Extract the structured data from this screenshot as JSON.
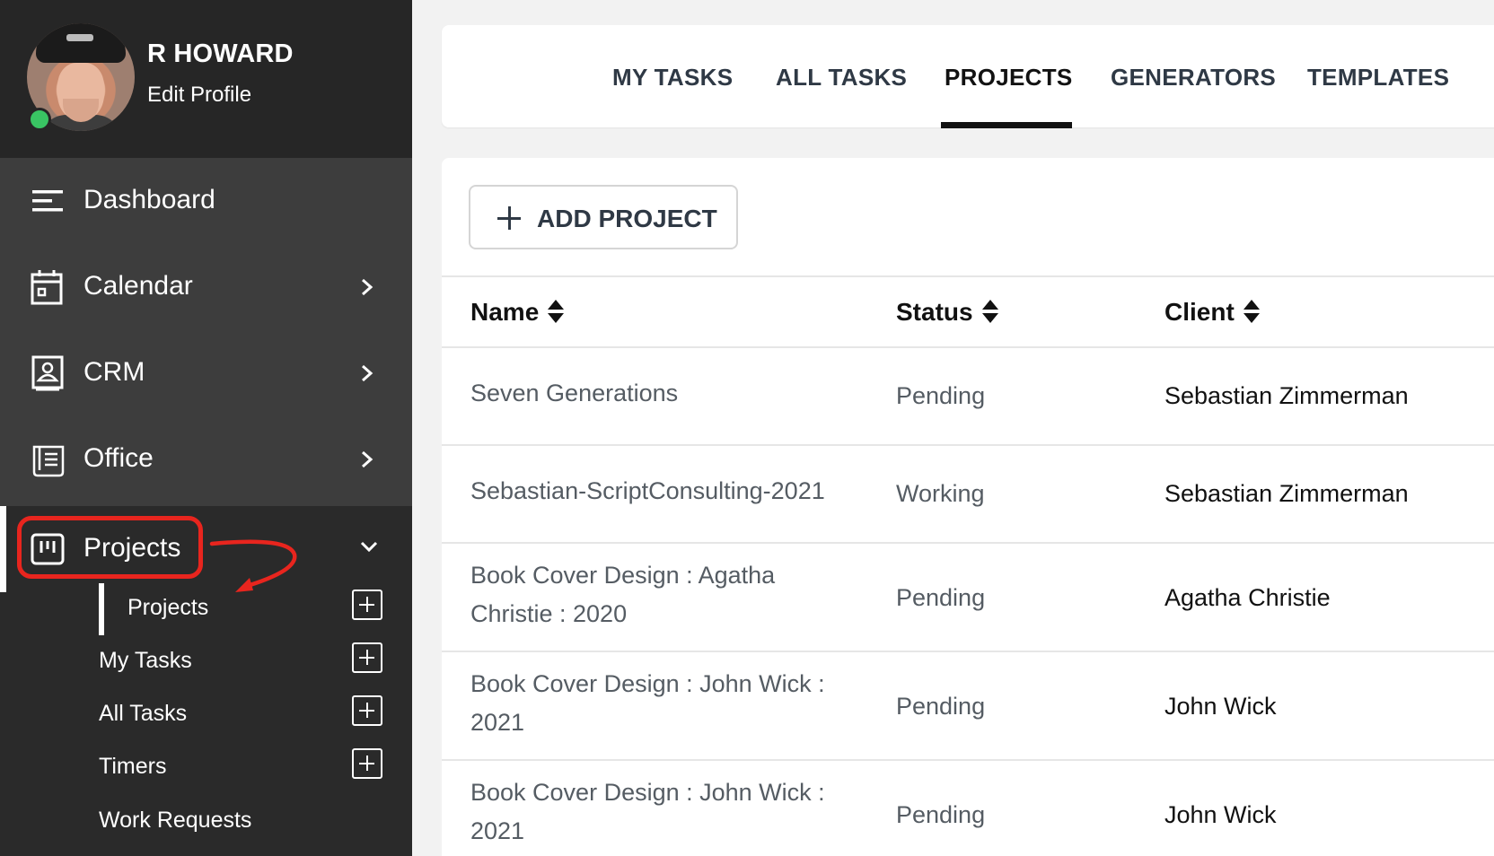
{
  "profile": {
    "name": "R HOWARD",
    "edit_label": "Edit Profile",
    "status_color": "#39c463"
  },
  "nav": {
    "items": [
      {
        "label": "Dashboard",
        "icon": "menu-icon"
      },
      {
        "label": "Calendar",
        "icon": "calendar-icon"
      },
      {
        "label": "CRM",
        "icon": "contact-card-icon"
      },
      {
        "label": "Office",
        "icon": "office-icon"
      }
    ],
    "active": {
      "label": "Projects",
      "icon": "kanban-board-icon"
    },
    "sub_items": [
      {
        "label": "Projects"
      },
      {
        "label": "My Tasks"
      },
      {
        "label": "All Tasks"
      },
      {
        "label": "Timers"
      },
      {
        "label": "Work Requests"
      }
    ]
  },
  "tabs": [
    {
      "label": "MY TASKS"
    },
    {
      "label": "ALL TASKS"
    },
    {
      "label": "PROJECTS"
    },
    {
      "label": "GENERATORS"
    },
    {
      "label": "TEMPLATES"
    }
  ],
  "toolbar": {
    "add_label": "ADD PROJECT"
  },
  "table": {
    "headers": {
      "name": "Name",
      "status": "Status",
      "client": "Client"
    },
    "rows": [
      {
        "name": "Seven Generations",
        "status": "Pending",
        "client": "Sebastian Zimmerman"
      },
      {
        "name": "Sebastian-ScriptConsulting-2021",
        "status": "Working",
        "client": "Sebastian Zimmerman"
      },
      {
        "name": "Book Cover Design : Agatha Christie : 2020",
        "status": "Pending",
        "client": "Agatha Christie"
      },
      {
        "name": "Book Cover Design : John Wick : 2021",
        "status": "Pending",
        "client": "John Wick"
      },
      {
        "name": "Book Cover Design : John Wick : 2021",
        "status": "Pending",
        "client": "John Wick"
      }
    ]
  },
  "colors": {
    "highlight": "#e8251e",
    "sidebar_bg": "#2a2a2a",
    "sidebar_group_bg": "#3d3d3d"
  }
}
